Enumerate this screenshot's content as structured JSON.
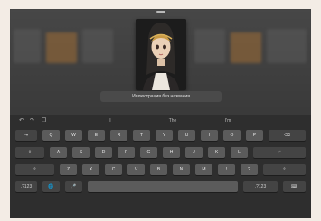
{
  "dialog": {
    "title_value": "Иллюстрация без названия"
  },
  "suggestions": [
    "I",
    "The",
    "I'm"
  ],
  "toolbar_icons": [
    "undo-icon",
    "redo-icon",
    "clipboard-icon"
  ],
  "keyboard": {
    "row1": [
      "Q",
      "W",
      "E",
      "R",
      "T",
      "Y",
      "U",
      "I",
      "O",
      "P"
    ],
    "row2": [
      "A",
      "S",
      "D",
      "F",
      "G",
      "H",
      "J",
      "K",
      "L"
    ],
    "row3": [
      "Z",
      "X",
      "C",
      "V",
      "B",
      "N",
      "M",
      "!",
      "?"
    ],
    "tab_label": "⇥",
    "caps_label": "⇪",
    "shift_label": "⇧",
    "delete_label": "⌫",
    "return_label": "↵",
    "numbers_label": ".?123",
    "globe_label": "🌐",
    "mic_label": "🎤",
    "hide_label": "⌨"
  },
  "colors": {
    "screen_bg": "#3b3b3b",
    "keyboard_bg": "#2e2e2e",
    "key_bg": "#5b5b5b"
  }
}
